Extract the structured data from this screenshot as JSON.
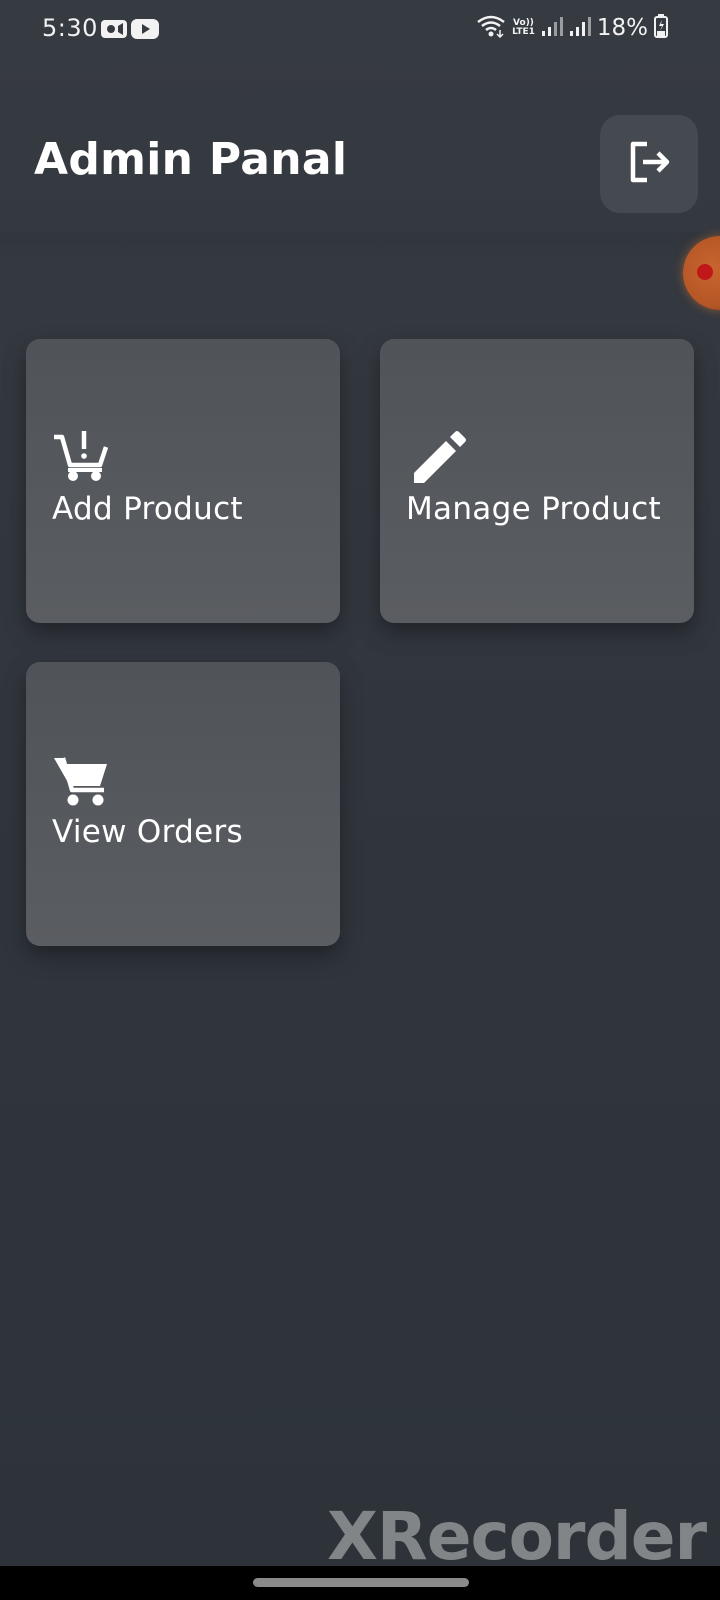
{
  "status_bar": {
    "time": "5:30",
    "network_label_top": "Vo))",
    "network_label_bottom": "LTE1",
    "battery_percent": "18%",
    "icons": [
      "video-camera-icon",
      "youtube-icon",
      "wifi-icon",
      "volte-icon",
      "signal-icon",
      "signal-icon",
      "battery-icon"
    ]
  },
  "header": {
    "title": "Admin Panal",
    "logout_icon": "logout-icon"
  },
  "dashboard": {
    "cards": [
      {
        "label": "Add Product",
        "icon": "add-cart-icon"
      },
      {
        "label": "Manage Product",
        "icon": "pencil-icon"
      },
      {
        "label": "View Orders",
        "icon": "shopping-cart-icon"
      }
    ]
  },
  "overlay": {
    "watermark": "XRecorder",
    "bubble_color": "#b45626"
  },
  "colors": {
    "background": "#333840",
    "card": "#56595e",
    "text": "#ffffff"
  }
}
